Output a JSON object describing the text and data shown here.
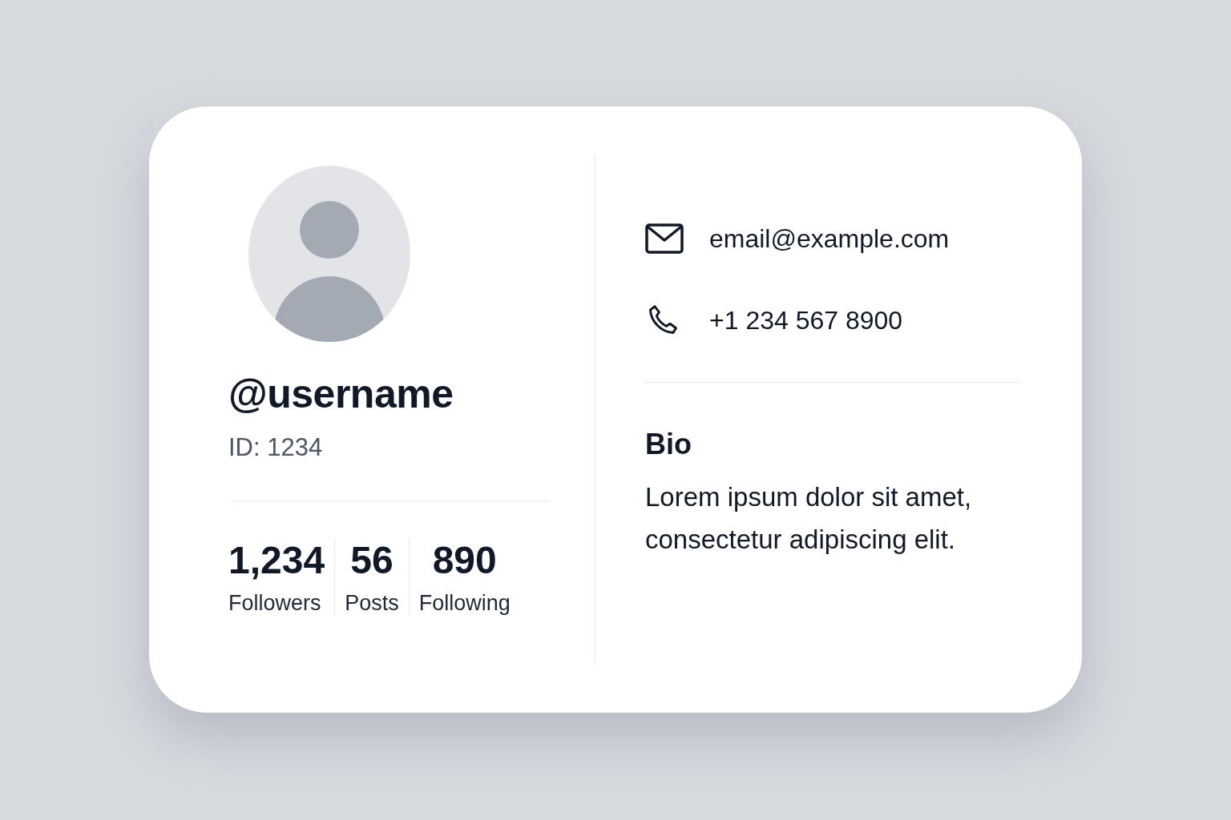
{
  "profile": {
    "username": "@username",
    "id": "ID: 1234",
    "stats": [
      {
        "value": "1,234",
        "label": "Followers"
      },
      {
        "value": "56",
        "label": "Posts"
      },
      {
        "value": "890",
        "label": "Following"
      }
    ]
  },
  "contacts": [
    {
      "kind": "email",
      "text": "email@example.com"
    },
    {
      "kind": "phone",
      "text": "+1 234 567 8900"
    }
  ],
  "bio": {
    "title": "Bio",
    "text": "Lorem ipsum dolor sit amet, consectetur adipiscing elit."
  }
}
